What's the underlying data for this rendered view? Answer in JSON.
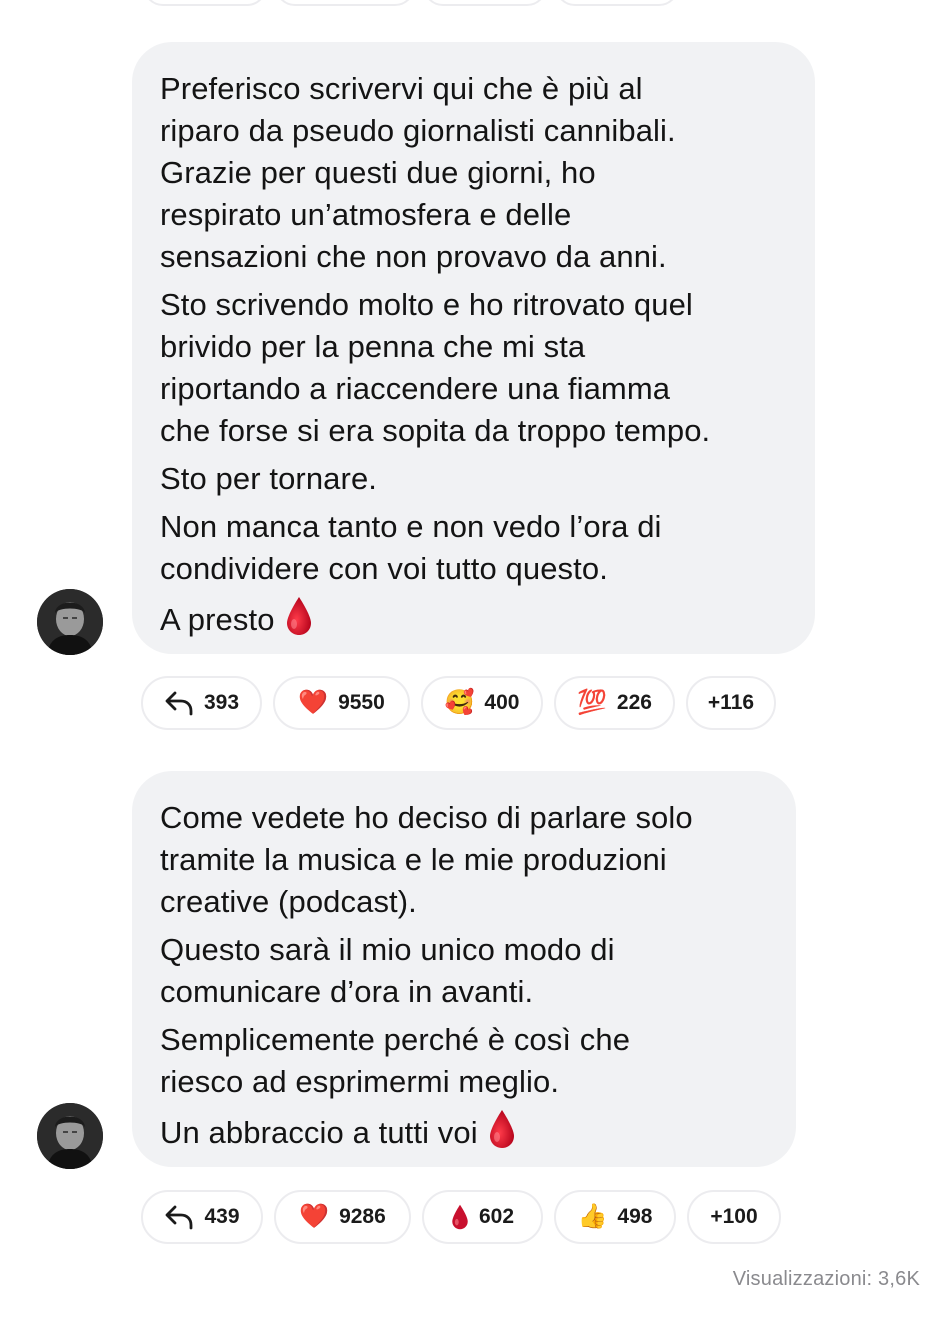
{
  "messages": [
    {
      "paragraphs": [
        "Preferisco scrivervi qui che è più al\nriparo da pseudo giornalisti cannibali.\nGrazie per questi due giorni, ho\nrespirato un’atmosfera e delle\nsensazioni che non provavo da anni.",
        "Sto scrivendo molto e ho ritrovato quel\nbrivido per la penna che mi sta\nriportando a riaccendere una fiamma\nche forse si era sopita da troppo tempo.",
        "Sto per tornare.",
        "Non manca tanto e non vedo l’ora di\ncondividere con voi tutto questo.",
        "A presto"
      ],
      "reactions": {
        "reply_count": "393",
        "heart": {
          "emoji": "❤️",
          "count": "9550"
        },
        "smile_hearts": {
          "emoji": "🥰",
          "count": "400"
        },
        "hundred": {
          "emoji": "💯",
          "count": "226"
        },
        "more": "+116"
      }
    },
    {
      "paragraphs": [
        "Come vedete ho deciso di parlare solo\ntramite la musica e le mie produzioni\ncreative (podcast).",
        "Questo sarà il mio unico modo di\ncomunicare d’ora in avanti.",
        "Semplicemente perché è così che\nriesco ad esprimermi meglio.",
        "Un abbraccio a tutti voi"
      ],
      "reactions": {
        "reply_count": "439",
        "heart": {
          "emoji": "❤️",
          "count": "9286"
        },
        "drop": {
          "emoji": "🩸",
          "count": "602"
        },
        "thumbs": {
          "emoji": "👍",
          "count": "498"
        },
        "more": "+100"
      }
    }
  ],
  "footer": {
    "views": "Visualizzazioni: 3,6K"
  },
  "icons": {
    "reply": "reply-arrow-icon",
    "blood_drop": "blood-drop-icon",
    "avatar": "avatar"
  },
  "colors": {
    "bubble_bg": "#f1f2f4",
    "pill_border": "#ececef",
    "blood_red": "#c8102e",
    "muted_text": "#8a8a8e"
  }
}
